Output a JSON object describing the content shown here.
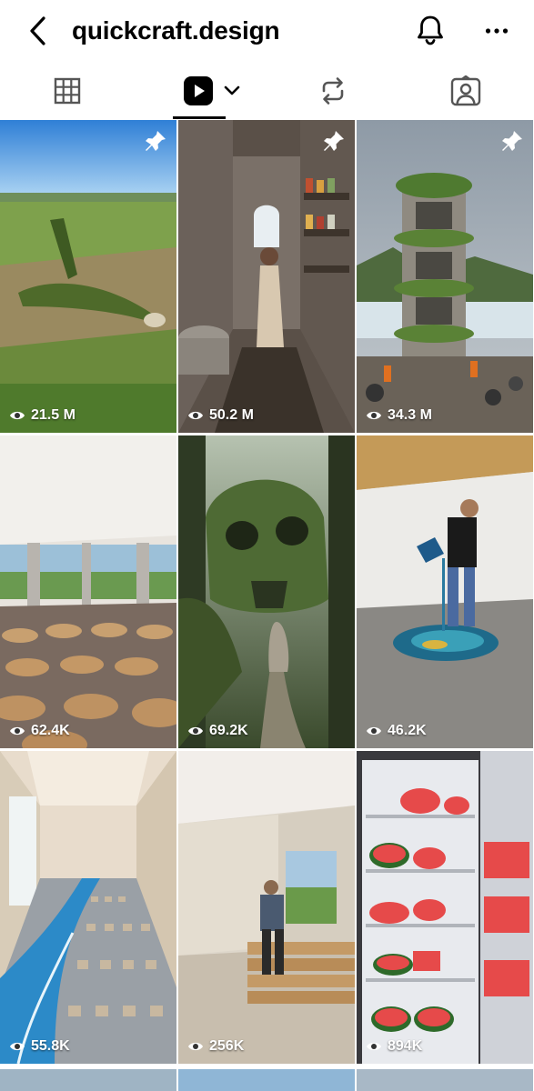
{
  "header": {
    "title": "quickcraft.design"
  },
  "tabs": [
    {
      "name": "grid"
    },
    {
      "name": "reels",
      "active": true
    },
    {
      "name": "reposts"
    },
    {
      "name": "tagged"
    }
  ],
  "reels": [
    {
      "views": "21.5 M",
      "pinned": true,
      "icon": "eye-icon"
    },
    {
      "views": "50.2 M",
      "pinned": true,
      "icon": "eye-icon"
    },
    {
      "views": "34.3 M",
      "pinned": true,
      "icon": "eye-icon"
    },
    {
      "views": "62.4K",
      "pinned": false,
      "icon": "eye-icon"
    },
    {
      "views": "69.2K",
      "pinned": false,
      "icon": "eye-icon"
    },
    {
      "views": "46.2K",
      "pinned": false,
      "icon": "eye-icon"
    },
    {
      "views": "55.8K",
      "pinned": false,
      "icon": "eye-icon"
    },
    {
      "views": "256K",
      "pinned": false,
      "icon": "eye-icon"
    },
    {
      "views": "894K",
      "pinned": false,
      "icon": "eye-icon"
    }
  ],
  "colors": {
    "text": "#000000",
    "background": "#ffffff",
    "overlay_text": "#ffffff"
  }
}
